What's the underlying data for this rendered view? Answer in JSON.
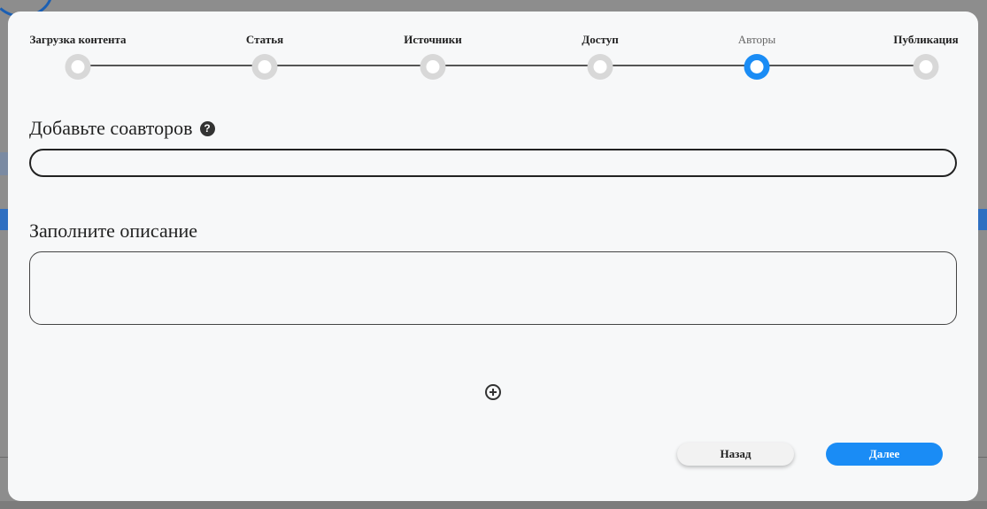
{
  "steps": [
    {
      "label": "Загрузка контента",
      "state": "done"
    },
    {
      "label": "Статья",
      "state": "done"
    },
    {
      "label": "Источники",
      "state": "done"
    },
    {
      "label": "Доступ",
      "state": "done"
    },
    {
      "label": "Авторы",
      "state": "active"
    },
    {
      "label": "Публикация",
      "state": "pending"
    }
  ],
  "coauthors": {
    "title": "Добавьте соавторов",
    "help_icon": "question-mark-icon",
    "value": ""
  },
  "description": {
    "title": "Заполните описание",
    "value": ""
  },
  "add_icon": "plus-circle-icon",
  "buttons": {
    "back": "Назад",
    "next": "Далее"
  },
  "colors": {
    "accent": "#1a8cf5",
    "inactive_dot": "#d8d8d8"
  }
}
